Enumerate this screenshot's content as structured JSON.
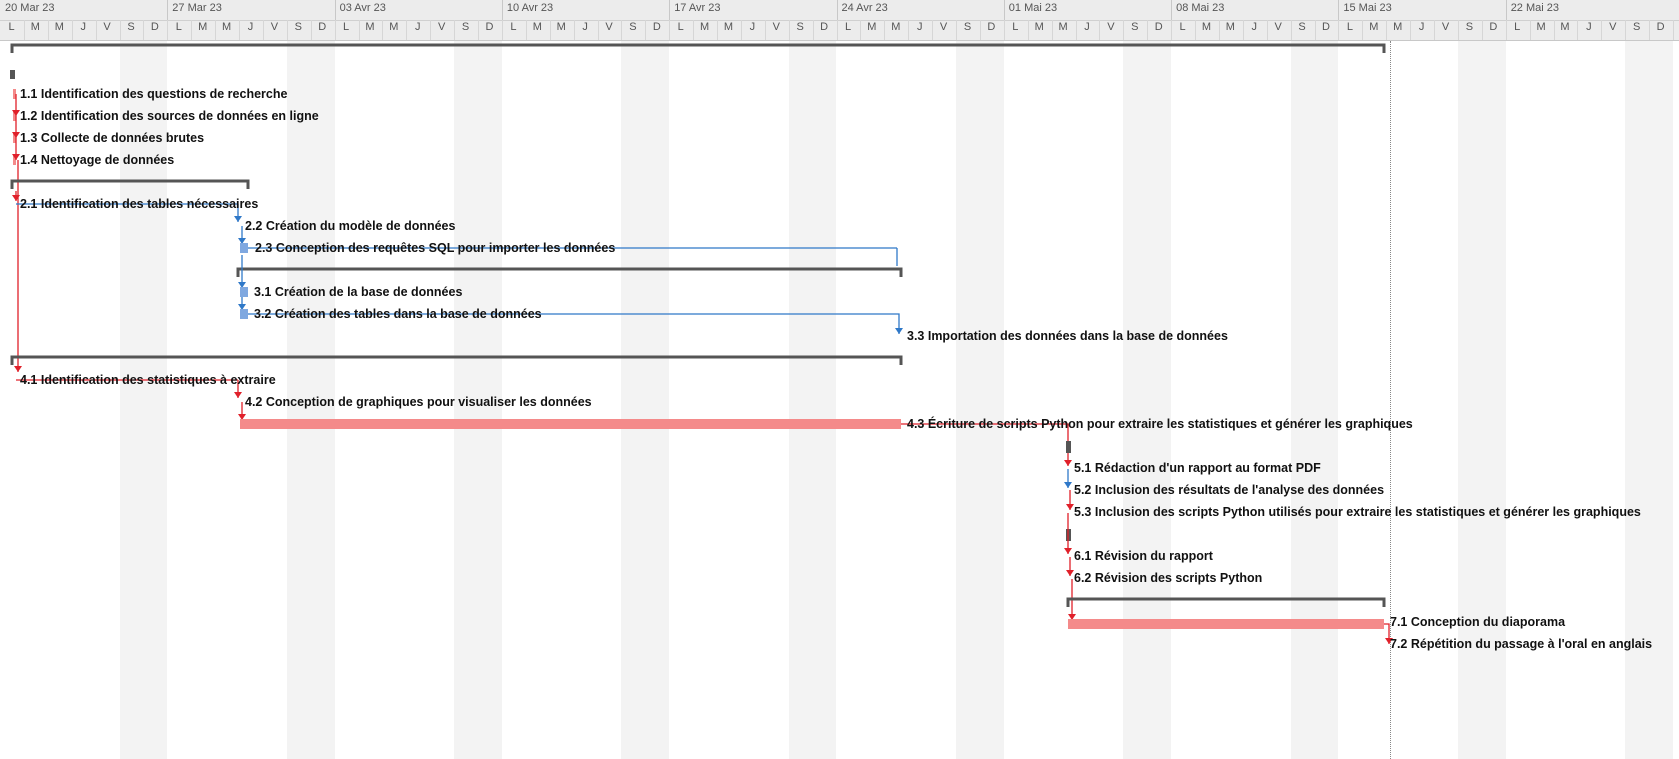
{
  "timeline": {
    "weeks": [
      "20 Mar 23",
      "27 Mar 23",
      "03 Avr 23",
      "10 Avr 23",
      "17 Avr 23",
      "24 Avr 23",
      "01 Mai 23",
      "08 Mai 23",
      "15 Mai 23",
      "22 Mai 23"
    ],
    "day_letters": [
      "L",
      "M",
      "M",
      "J",
      "V",
      "S",
      "D"
    ]
  },
  "tasks": [
    {
      "label": "1.1 Identification des questions de recherche"
    },
    {
      "label": "1.2 Identification des sources de données en ligne"
    },
    {
      "label": "1.3 Collecte de données brutes"
    },
    {
      "label": "1.4 Nettoyage de données"
    },
    {
      "label": "2.1 Identification des tables nécessaires"
    },
    {
      "label": "2.2 Création du modèle de données"
    },
    {
      "label": "2.3 Conception des requêtes SQL pour importer les données"
    },
    {
      "label": "3.1 Création de la base de données"
    },
    {
      "label": "3.2 Création des tables dans la base de données"
    },
    {
      "label": "3.3 Importation des données dans la base de données"
    },
    {
      "label": "4.1 Identification des statistiques à extraire"
    },
    {
      "label": "4.2 Conception de graphiques pour visualiser les données"
    },
    {
      "label": "4.3 Écriture de scripts Python pour extraire les statistiques et générer les graphiques"
    },
    {
      "label": "5.1 Rédaction d'un rapport au format PDF"
    },
    {
      "label": "5.2 Inclusion des résultats de l'analyse des données"
    },
    {
      "label": "5.3 Inclusion des scripts Python utilisés pour extraire les statistiques et générer les graphiques"
    },
    {
      "label": "6.1 Révision du rapport"
    },
    {
      "label": "6.2 Révision des scripts Python"
    },
    {
      "label": "7.1 Conception du diaporama"
    },
    {
      "label": "7.2 Répétition du passage à l'oral en anglais"
    }
  ],
  "colors": {
    "critical": "#f48a8a",
    "critical_link": "#e0202a",
    "normal_bar": "#7fa8e0",
    "normal_link": "#2f78c8",
    "summary": "#555555",
    "weekend": "#f3f3f3"
  }
}
